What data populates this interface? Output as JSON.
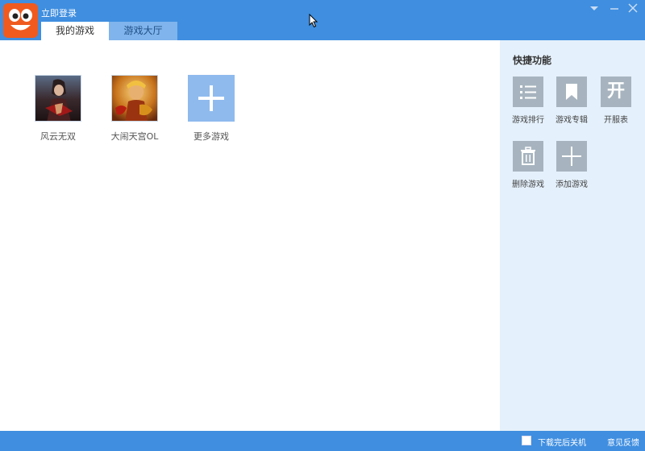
{
  "titlebar": {
    "login_label": "立即登录",
    "tabs": [
      {
        "label": "我的游戏",
        "active": true
      },
      {
        "label": "游戏大厅",
        "active": false
      }
    ]
  },
  "games": [
    {
      "label": "风云无双",
      "icon": "fengyun-game-icon"
    },
    {
      "label": "大闹天宫OL",
      "icon": "danao-game-icon"
    },
    {
      "label": "更多游戏",
      "icon": "plus-icon"
    }
  ],
  "sidebar": {
    "title": "快捷功能",
    "items": [
      {
        "label": "游戏排行",
        "icon": "list-icon"
      },
      {
        "label": "游戏专辑",
        "icon": "bookmark-icon"
      },
      {
        "label": "开服表",
        "icon": "kai-icon",
        "glyph": "开"
      },
      {
        "label": "删除游戏",
        "icon": "trash-icon"
      },
      {
        "label": "添加游戏",
        "icon": "plus-icon"
      }
    ]
  },
  "statusbar": {
    "shutdown_label": "下载完后关机",
    "feedback_label": "意见反馈"
  },
  "colors": {
    "accent": "#3f8ee0",
    "sidebar_bg": "#e4f0fb",
    "inactive_tab": "#7fb4ec",
    "tile_gray": "#a7b4bf",
    "more_games_tile": "#8fbaee"
  }
}
